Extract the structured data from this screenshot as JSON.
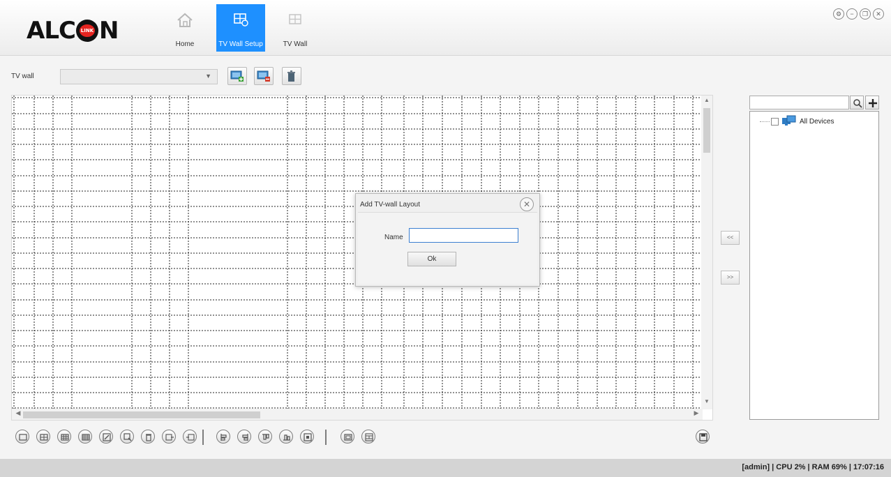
{
  "brand": {
    "name_prefix": "ALC",
    "name_suffix": "N",
    "badge": "LINK",
    "accent": "#e52420"
  },
  "nav": {
    "tabs": [
      {
        "label": "Home",
        "icon": "home-icon",
        "active": false
      },
      {
        "label": "TV Wall Setup",
        "icon": "tv-wall-setup-icon",
        "active": true
      },
      {
        "label": "TV Wall",
        "icon": "tv-wall-icon",
        "active": false
      }
    ],
    "active_color": "#1e90ff"
  },
  "window_controls": [
    "settings-icon",
    "minimize-icon",
    "restore-icon",
    "close-icon"
  ],
  "toolbar": {
    "label": "TV wall",
    "select_value": "",
    "buttons": [
      "add-monitor-icon",
      "remove-monitor-icon",
      "delete-icon"
    ]
  },
  "dialog": {
    "title": "Add TV-wall Layout",
    "name_label": "Name",
    "name_value": "",
    "ok_label": "Ok"
  },
  "move_buttons": [
    "<<",
    ">>"
  ],
  "device_panel": {
    "search_placeholder": "",
    "tree_root": "All Devices"
  },
  "bottom_tools": [
    "layout-1-icon",
    "layout-4-icon",
    "layout-9-icon",
    "layout-16-icon",
    "edit-icon",
    "zoom-icon",
    "trash-icon",
    "move-left-icon",
    "move-right-icon",
    "align-left-icon",
    "align-right-icon",
    "align-top-icon",
    "align-bottom-icon",
    "fit-icon",
    "window-icon",
    "merge-icon"
  ],
  "status": {
    "text": "[admin] | CPU  2% | RAM  69% | 17:07:16"
  }
}
